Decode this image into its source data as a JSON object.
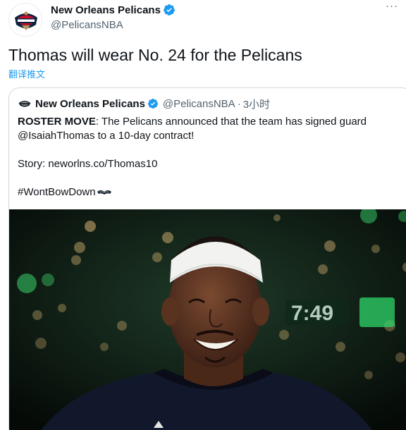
{
  "tweet": {
    "author": {
      "display_name": "New Orleans Pelicans",
      "handle": "@PelicansNBA",
      "verified": true,
      "avatar_icon": "pelicans-logo-icon"
    },
    "more_label": "···",
    "text": "Thomas will wear No. 24 for the Pelicans",
    "translate_label": "翻译推文"
  },
  "quoted_tweet": {
    "author": {
      "display_name": "New Orleans Pelicans",
      "handle": "@PelicansNBA",
      "separator": "·",
      "time": "3小时",
      "verified": true
    },
    "lead_bold": "ROSTER MOVE",
    "line1_rest": ": The Pelicans announced that the team has signed guard",
    "line2": "@IsaiahThomas to a 10-day contract!",
    "story_line": "Story: neworlns.co/Thomas10",
    "hashtag": "#WontBowDown",
    "hashtag_emoji": "wings-icon",
    "photo": {
      "description_icon": "player-photo",
      "scoreboard_text": "7:49"
    }
  },
  "colors": {
    "link_blue": "#1d9bf0",
    "text_primary": "#0f1419",
    "text_secondary": "#536471",
    "border": "#cfd9de",
    "pelicans_navy": "#0c2340",
    "pelicans_gold": "#b4975a",
    "pelicans_red": "#c8102e"
  }
}
